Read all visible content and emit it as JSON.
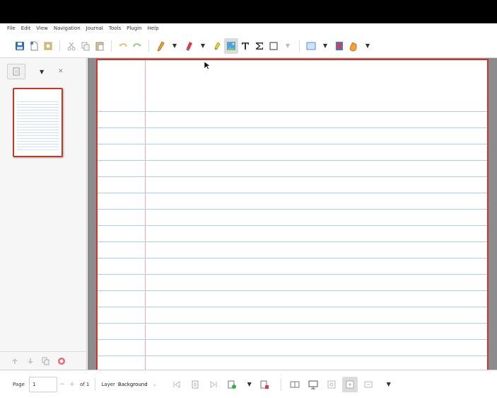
{
  "menu": {
    "items": [
      "File",
      "Edit",
      "View",
      "Navigation",
      "Journal",
      "Tools",
      "Plugin",
      "Help"
    ]
  },
  "status": {
    "page_label": "Page",
    "page_value": "1",
    "minus": "−",
    "plus": "+",
    "of_label": "of 1",
    "layer_label": "Layer",
    "layer_value": "Background"
  },
  "colors": {
    "accent_red": "#d2332b",
    "rule_blue": "#a9cdf2",
    "margin_pink": "#f2a5c6",
    "canvas_gray": "#8c8c8c"
  },
  "icons": {
    "toolbar": [
      "save-icon",
      "new-page-icon",
      "layer-icon",
      "cut-icon",
      "copy-icon",
      "paste-icon",
      "undo-icon",
      "redo-icon",
      "pen-icon",
      "eraser-icon",
      "highlighter-icon",
      "image-icon",
      "text-icon",
      "math-icon",
      "shape-icon",
      "color-icon",
      "vertical-space-icon",
      "hand-icon"
    ],
    "status": [
      "first-page-icon",
      "goto-page-icon",
      "last-page-icon",
      "insert-page-icon",
      "delete-page-icon",
      "two-pages-icon",
      "presentation-icon",
      "zoom-fit-icon",
      "zoom-100-icon",
      "zoom-out-icon"
    ]
  }
}
